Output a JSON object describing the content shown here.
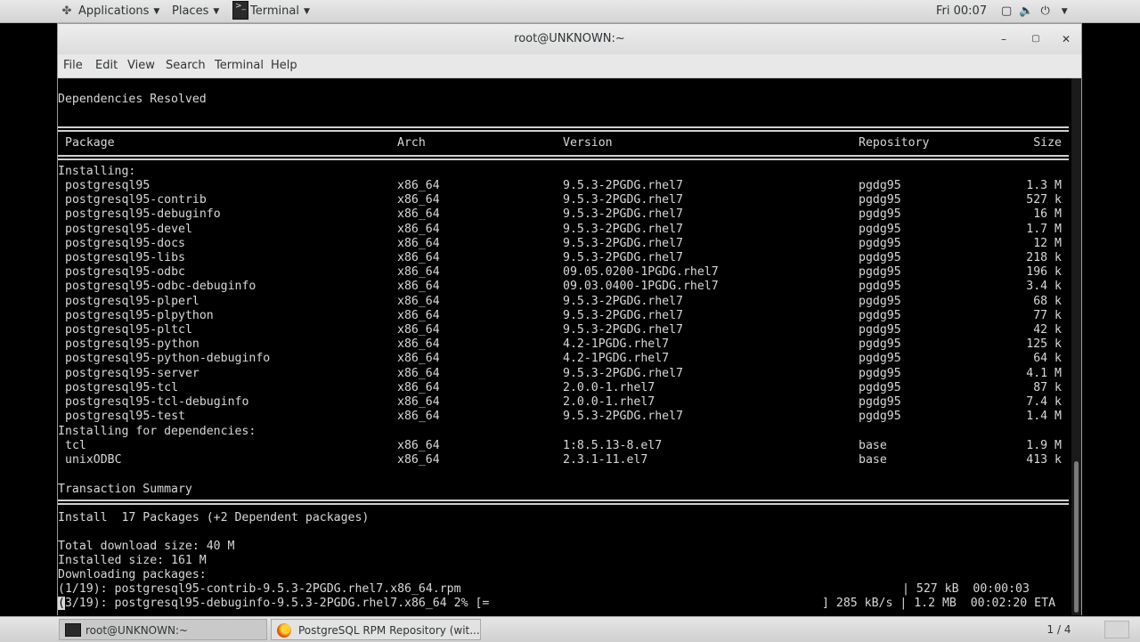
{
  "top_panel": {
    "applications": "Applications",
    "places": "Places",
    "terminal": "Terminal",
    "clock": "Fri 00:07",
    "status_icons": [
      "screen-icon",
      "volume-icon",
      "power-icon"
    ]
  },
  "window": {
    "title": "root@UNKNOWN:~",
    "menu": [
      "File",
      "Edit",
      "View",
      "Search",
      "Terminal",
      "Help"
    ]
  },
  "terminal": {
    "deps_resolved": "Dependencies Resolved",
    "headers": {
      "package": "Package",
      "arch": "Arch",
      "version": "Version",
      "repository": "Repository",
      "size": "Size"
    },
    "installing_label": "Installing:",
    "packages": [
      {
        "name": "postgresql95",
        "arch": "x86_64",
        "version": "9.5.3-2PGDG.rhel7",
        "repo": "pgdg95",
        "size": "1.3 M"
      },
      {
        "name": "postgresql95-contrib",
        "arch": "x86_64",
        "version": "9.5.3-2PGDG.rhel7",
        "repo": "pgdg95",
        "size": "527 k"
      },
      {
        "name": "postgresql95-debuginfo",
        "arch": "x86_64",
        "version": "9.5.3-2PGDG.rhel7",
        "repo": "pgdg95",
        "size": "16 M"
      },
      {
        "name": "postgresql95-devel",
        "arch": "x86_64",
        "version": "9.5.3-2PGDG.rhel7",
        "repo": "pgdg95",
        "size": "1.7 M"
      },
      {
        "name": "postgresql95-docs",
        "arch": "x86_64",
        "version": "9.5.3-2PGDG.rhel7",
        "repo": "pgdg95",
        "size": "12 M"
      },
      {
        "name": "postgresql95-libs",
        "arch": "x86_64",
        "version": "9.5.3-2PGDG.rhel7",
        "repo": "pgdg95",
        "size": "218 k"
      },
      {
        "name": "postgresql95-odbc",
        "arch": "x86_64",
        "version": "09.05.0200-1PGDG.rhel7",
        "repo": "pgdg95",
        "size": "196 k"
      },
      {
        "name": "postgresql95-odbc-debuginfo",
        "arch": "x86_64",
        "version": "09.03.0400-1PGDG.rhel7",
        "repo": "pgdg95",
        "size": "3.4 k"
      },
      {
        "name": "postgresql95-plperl",
        "arch": "x86_64",
        "version": "9.5.3-2PGDG.rhel7",
        "repo": "pgdg95",
        "size": "68 k"
      },
      {
        "name": "postgresql95-plpython",
        "arch": "x86_64",
        "version": "9.5.3-2PGDG.rhel7",
        "repo": "pgdg95",
        "size": "77 k"
      },
      {
        "name": "postgresql95-pltcl",
        "arch": "x86_64",
        "version": "9.5.3-2PGDG.rhel7",
        "repo": "pgdg95",
        "size": "42 k"
      },
      {
        "name": "postgresql95-python",
        "arch": "x86_64",
        "version": "4.2-1PGDG.rhel7",
        "repo": "pgdg95",
        "size": "125 k"
      },
      {
        "name": "postgresql95-python-debuginfo",
        "arch": "x86_64",
        "version": "4.2-1PGDG.rhel7",
        "repo": "pgdg95",
        "size": "64 k"
      },
      {
        "name": "postgresql95-server",
        "arch": "x86_64",
        "version": "9.5.3-2PGDG.rhel7",
        "repo": "pgdg95",
        "size": "4.1 M"
      },
      {
        "name": "postgresql95-tcl",
        "arch": "x86_64",
        "version": "2.0.0-1.rhel7",
        "repo": "pgdg95",
        "size": "87 k"
      },
      {
        "name": "postgresql95-tcl-debuginfo",
        "arch": "x86_64",
        "version": "2.0.0-1.rhel7",
        "repo": "pgdg95",
        "size": "7.4 k"
      },
      {
        "name": "postgresql95-test",
        "arch": "x86_64",
        "version": "9.5.3-2PGDG.rhel7",
        "repo": "pgdg95",
        "size": "1.4 M"
      }
    ],
    "deps_label": "Installing for dependencies:",
    "dependencies": [
      {
        "name": "tcl",
        "arch": "x86_64",
        "version": "1:8.5.13-8.el7",
        "repo": "base",
        "size": "1.9 M"
      },
      {
        "name": "unixODBC",
        "arch": "x86_64",
        "version": "2.3.1-11.el7",
        "repo": "base",
        "size": "413 k"
      }
    ],
    "transaction_summary": "Transaction Summary",
    "install_line": "Install  17 Packages (+2 Dependent packages)",
    "total_download": "Total download size: 40 M",
    "installed_size": "Installed size: 161 M",
    "downloading": "Downloading packages:",
    "dl1_left": "(1/19): postgresql95-contrib-9.5.3-2PGDG.rhel7.x86_64.rpm",
    "dl1_right": "| 527 kB  00:00:03",
    "dl2_cursor": "(",
    "dl2_left": "3/19): postgresql95-debuginfo-9.5.3-2PGDG.rhel7.x86_64 2% [=",
    "dl2_right": "] 285 kB/s | 1.2 MB  00:02:20 ETA"
  },
  "taskbar": {
    "task_terminal": "root@UNKNOWN:~",
    "task_firefox": "PostgreSQL RPM Repository (wit...",
    "workspace": "1 / 4"
  }
}
